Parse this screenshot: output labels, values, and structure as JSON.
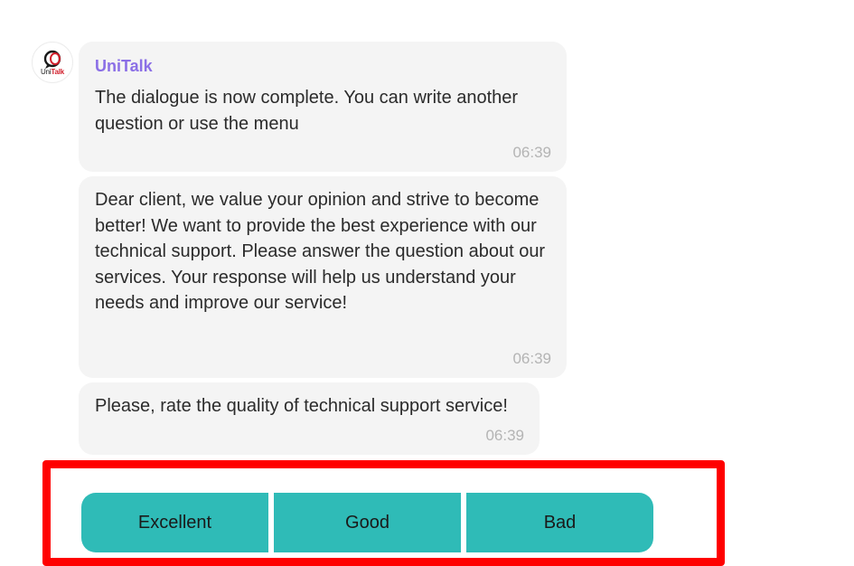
{
  "bot": {
    "name": "UniTalk",
    "logo_text_part1": "Uni",
    "logo_text_part2": "Talk"
  },
  "messages": [
    {
      "sender": "UniTalk",
      "text": "The dialogue is now complete. You can write another question or use the menu",
      "time": "06:39"
    },
    {
      "text": "Dear client, we value your opinion and strive to become better! We want to provide the best experience with our technical support. Please answer the question about our services. Your response will help us understand your needs and improve our service!",
      "time": "06:39"
    },
    {
      "text": "Please, rate the quality of technical support service!",
      "time": "06:39"
    }
  ],
  "rating_buttons": [
    "Excellent",
    "Good",
    "Bad"
  ],
  "colors": {
    "sender_name": "#8b6fe6",
    "bubble_bg": "#f4f4f4",
    "button_bg": "#2fbbb7",
    "highlight_frame": "#ff0000"
  }
}
